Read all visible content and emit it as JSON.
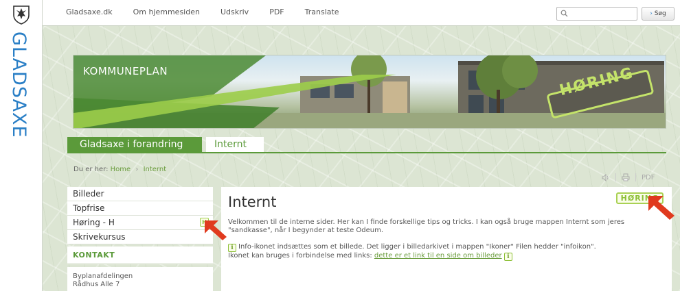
{
  "brand": {
    "wordmark": "GLADSAXE",
    "crest_icon": "coat-of-arms-icon"
  },
  "topnav": {
    "links": [
      "Gladsaxe.dk",
      "Om hjemmesiden",
      "Udskriv",
      "PDF",
      "Translate"
    ],
    "search_placeholder": "",
    "search_button": "Søg",
    "search_icon": "search-icon"
  },
  "hero": {
    "title": "KOMMUNEPLAN",
    "stamp": "HØRING"
  },
  "tabs": {
    "active": "Gladsaxe i forandring",
    "inactive": "Internt"
  },
  "breadcrumb": {
    "prefix": "Du er her:",
    "home": "Home",
    "current": "Internt"
  },
  "tools": {
    "listen_icon": "speaker-icon",
    "print_icon": "print-icon",
    "pdf": "PDF"
  },
  "leftmenu": {
    "items": [
      {
        "label": "Billeder"
      },
      {
        "label": "Topfrise"
      },
      {
        "label": "Høring - H",
        "badge": "H"
      },
      {
        "label": "Skrivekursus"
      }
    ],
    "contact_heading": "KONTAKT",
    "contact_lines": [
      "Byplanafdelingen",
      "Rådhus Alle  7"
    ]
  },
  "content": {
    "title": "Internt",
    "badge": "HØRING",
    "para1": "Velkommen til de interne sider. Her kan I finde forskellige tips og tricks. I kan også bruge mappen Internt som jeres \"sandkasse\", når I begynder at teste Odeum.",
    "para2_a": "Info-ikonet indsættes som et billede. Det ligger i billedarkivet i mappen \"Ikoner\" Filen hedder \"infoikon\".",
    "para2_b": "Ikonet kan bruges i forbindelse med links: ",
    "para2_link": "dette er et link til en side om billeder",
    "info_glyph": "i"
  },
  "colors": {
    "accent": "#5b9a3a",
    "brand_blue": "#2a7fc6",
    "badge_green": "#8cbf36",
    "arrow_red": "#e03a1e"
  }
}
